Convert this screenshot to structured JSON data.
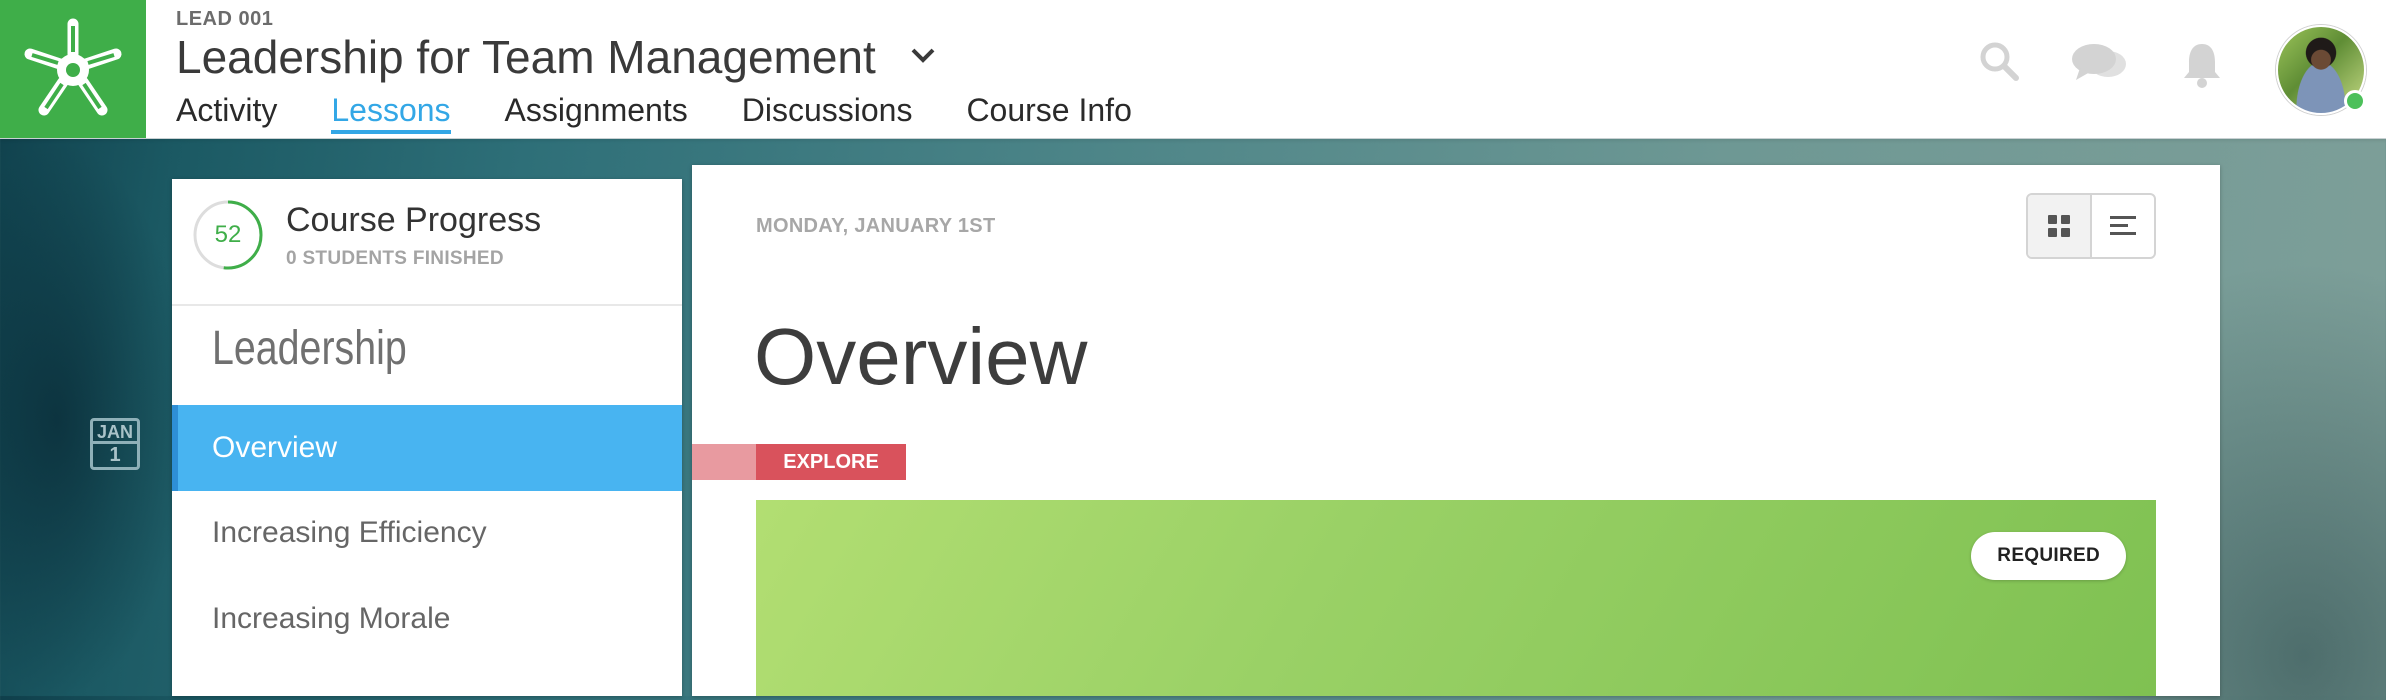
{
  "course": {
    "code": "LEAD 001",
    "title": "Leadership for Team Management"
  },
  "nav": {
    "tabs": [
      {
        "label": "Activity",
        "active": false
      },
      {
        "label": "Lessons",
        "active": true
      },
      {
        "label": "Assignments",
        "active": false
      },
      {
        "label": "Discussions",
        "active": false
      },
      {
        "label": "Course Info",
        "active": false
      }
    ]
  },
  "header_icons": [
    "search-icon",
    "chat-icon",
    "bell-icon",
    "avatar"
  ],
  "date_marker": {
    "month": "JAN",
    "day": "1"
  },
  "progress": {
    "value": "52",
    "percent": 52,
    "title": "Course Progress",
    "subtitle": "0 STUDENTS FINISHED"
  },
  "sidebar": {
    "section": "Leadership",
    "items": [
      {
        "label": "Overview",
        "active": true
      },
      {
        "label": "Increasing Efficiency",
        "active": false
      },
      {
        "label": "Increasing Morale",
        "active": false
      }
    ]
  },
  "main": {
    "date": "MONDAY, JANUARY 1ST",
    "title": "Overview",
    "tag": "EXPLORE",
    "badge": "REQUIRED"
  },
  "colors": {
    "brand_green": "#3fae49",
    "accent_blue": "#33a7e6",
    "active_item": "#48b4f1",
    "explore_red": "#d9525c"
  }
}
